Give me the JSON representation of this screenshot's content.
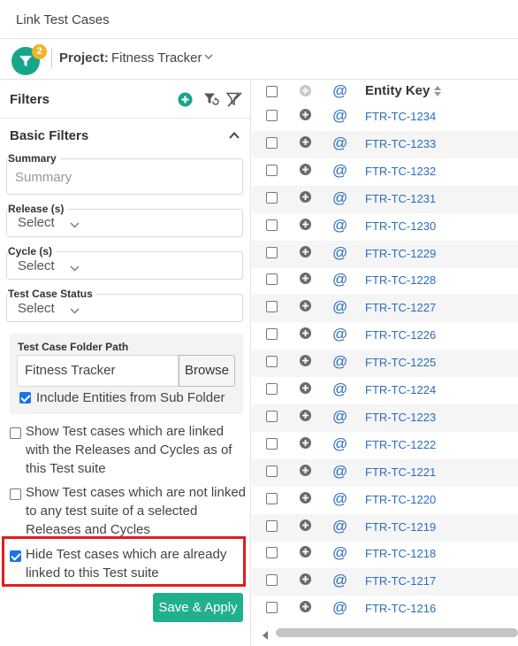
{
  "window": {
    "title": "Link Test Cases"
  },
  "project": {
    "filter_badge_count": "2",
    "label": "Project:",
    "value": "Fitness Tracker"
  },
  "filters": {
    "header": "Filters",
    "basic_filters": "Basic Filters",
    "summary": {
      "label": "Summary",
      "placeholder": "Summary"
    },
    "release": {
      "label": "Release (s)",
      "value": "Select"
    },
    "cycle": {
      "label": "Cycle (s)",
      "value": "Select"
    },
    "status": {
      "label": "Test Case Status",
      "value": "Select"
    },
    "folder": {
      "label": "Test Case Folder Path",
      "value": "Fitness Tracker",
      "browse": "Browse",
      "include_sub": "Include Entities from Sub Folder",
      "include_sub_checked": true
    },
    "options": [
      {
        "text": "Show Test cases which are linked with the Releases and Cycles as of this Test suite",
        "checked": false
      },
      {
        "text": "Show Test cases which are not linked to any test suite of a selected Releases and Cycles",
        "checked": false
      },
      {
        "text": "Hide Test cases which are already linked to this Test suite",
        "checked": true
      }
    ],
    "save_apply": "Save & Apply",
    "highlight_color": "#e01e1e",
    "accent_color": "#21b08e"
  },
  "table": {
    "header": {
      "entity_key": "Entity Key",
      "at_symbol": "@"
    },
    "rows": [
      {
        "key": "FTR-TC-1234",
        "at": "@"
      },
      {
        "key": "FTR-TC-1233",
        "at": "@"
      },
      {
        "key": "FTR-TC-1232",
        "at": "@"
      },
      {
        "key": "FTR-TC-1231",
        "at": "@"
      },
      {
        "key": "FTR-TC-1230",
        "at": "@"
      },
      {
        "key": "FTR-TC-1229",
        "at": "@"
      },
      {
        "key": "FTR-TC-1228",
        "at": "@"
      },
      {
        "key": "FTR-TC-1227",
        "at": "@"
      },
      {
        "key": "FTR-TC-1226",
        "at": "@"
      },
      {
        "key": "FTR-TC-1225",
        "at": "@"
      },
      {
        "key": "FTR-TC-1224",
        "at": "@"
      },
      {
        "key": "FTR-TC-1223",
        "at": "@"
      },
      {
        "key": "FTR-TC-1222",
        "at": "@"
      },
      {
        "key": "FTR-TC-1221",
        "at": "@"
      },
      {
        "key": "FTR-TC-1220",
        "at": "@"
      },
      {
        "key": "FTR-TC-1219",
        "at": "@"
      },
      {
        "key": "FTR-TC-1218",
        "at": "@"
      },
      {
        "key": "FTR-TC-1217",
        "at": "@"
      },
      {
        "key": "FTR-TC-1216",
        "at": "@"
      }
    ]
  }
}
